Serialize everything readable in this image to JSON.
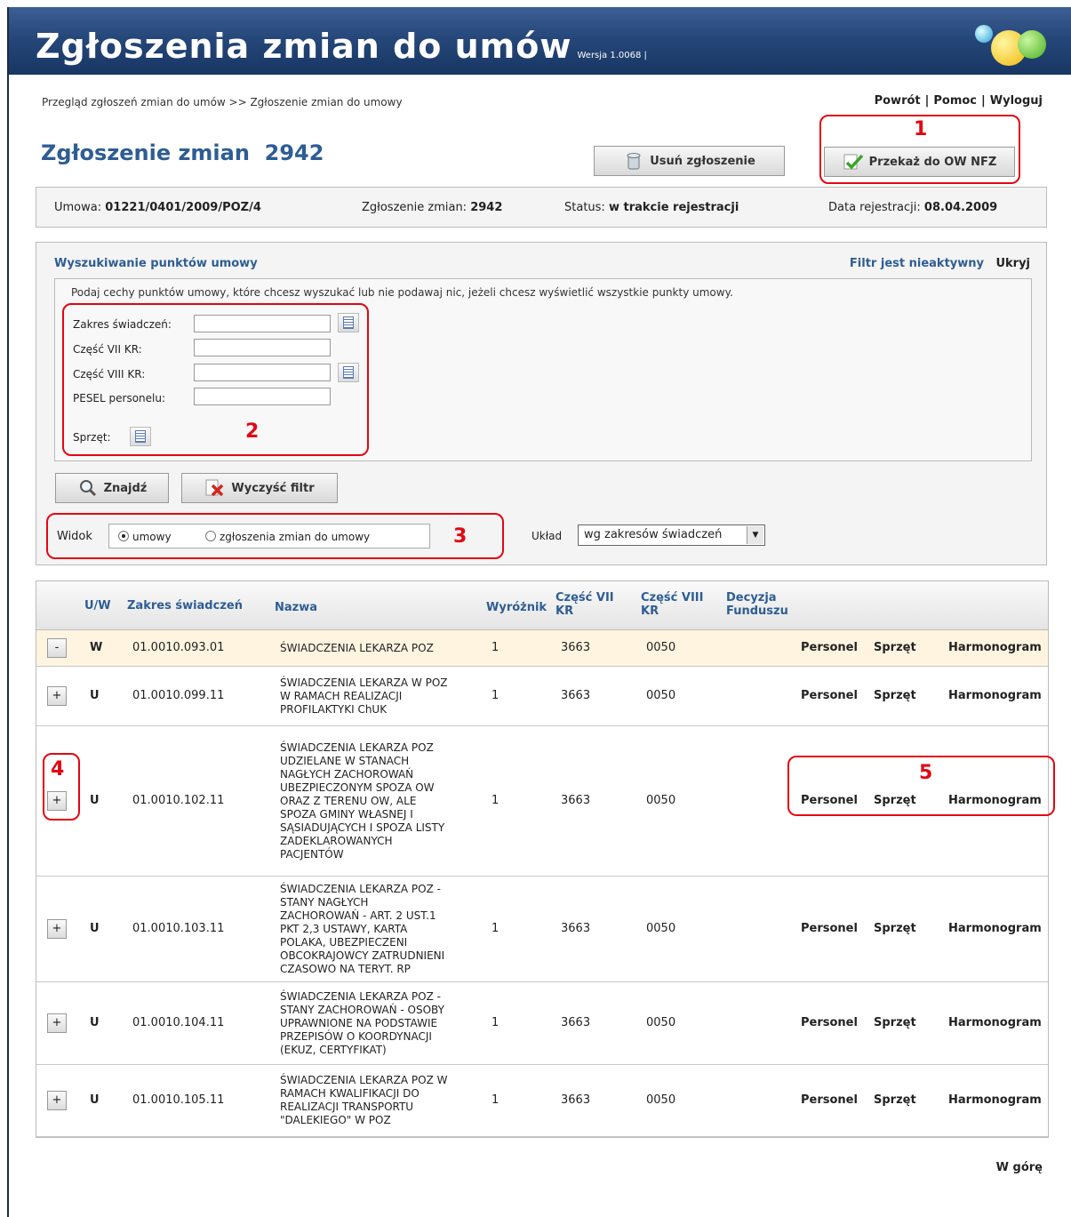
{
  "app": {
    "title": "Zgłoszenia zmian do umów",
    "version": "Wersja 1.0068 |"
  },
  "breadcrumb": "Przegląd zgłoszeń zmian do umów >> Zgłoszenie zmian do umowy",
  "top_links": {
    "back": "Powrót",
    "help": "Pomoc",
    "logout": "Wyloguj",
    "sep": "|"
  },
  "page_title": "Zgłoszenie zmian  2942",
  "buttons": {
    "delete": "Usuń zgłoszenie",
    "send": "Przekaż do OW NFZ",
    "find": "Znajdź",
    "clear": "Wyczyść filtr"
  },
  "info": {
    "contract_label": "Umowa:",
    "contract": "01221/0401/2009/POZ/4",
    "change_label": "Zgłoszenie zmian:",
    "change": "2942",
    "status_label": "Status:",
    "status": "w trakcie rejestracji",
    "date_label": "Data rejestracji:",
    "date": "08.04.2009"
  },
  "search": {
    "title": "Wyszukiwanie punktów umowy",
    "filter_status": "Filtr jest nieaktywny",
    "hide": "Ukryj",
    "hint": "Podaj cechy punktów umowy, które chcesz wyszukać lub nie podawaj nic, jeżeli chcesz wyświetlić wszystkie punkty umowy.",
    "fields": {
      "scope": "Zakres świadczeń:",
      "part7": "Część VII KR:",
      "part8": "Część VIII KR:",
      "pesel": "PESEL personelu:",
      "equipment": "Sprzęt:"
    }
  },
  "view": {
    "label": "Widok",
    "option1": "umowy",
    "option2": "zgłoszenia zmian do umowy",
    "layout_label": "Układ",
    "layout_value": "wg zakresów świadczeń"
  },
  "annotations": [
    "1",
    "2",
    "3",
    "4",
    "5"
  ],
  "table": {
    "headers": {
      "uw": "U/W",
      "scope": "Zakres świadczeń",
      "name": "Nazwa",
      "marker": "Wyróżnik",
      "part7a": "Część VII",
      "part7b": "KR",
      "part8a": "Część VIII",
      "part8b": "KR",
      "decisiona": "Decyzja",
      "decisionb": "Funduszu"
    },
    "actions": {
      "staff": "Personel",
      "equipment": "Sprzęt",
      "schedule": "Harmonogram"
    },
    "rows": [
      {
        "toggle": "-",
        "uw": "W",
        "code": "01.0010.093.01",
        "name": [
          "ŚWIADCZENIA LEKARZA POZ"
        ],
        "marker": "1",
        "part7": "3663",
        "part8": "0050"
      },
      {
        "toggle": "+",
        "uw": "U",
        "code": "01.0010.099.11",
        "name": [
          "ŚWIADCZENIA LEKARZA W POZ",
          "W RAMACH REALIZACJI",
          "PROFILAKTYKI ChUK"
        ],
        "marker": "1",
        "part7": "3663",
        "part8": "0050"
      },
      {
        "toggle": "+",
        "uw": "U",
        "code": "01.0010.102.11",
        "name": [
          "ŚWIADCZENIA LEKARZA POZ",
          "UDZIELANE W STANACH",
          "NAGŁYCH ZACHOROWAŃ",
          "UBEZPIECZONYM SPOZA OW",
          "ORAZ Z TERENU OW, ALE",
          "SPOZA GMINY WŁASNEJ I",
          "SĄSIADUJĄCYCH I SPOZA LISTY",
          "ZADEKLAROWANYCH",
          "PACJENTÓW"
        ],
        "marker": "1",
        "part7": "3663",
        "part8": "0050"
      },
      {
        "toggle": "+",
        "uw": "U",
        "code": "01.0010.103.11",
        "name": [
          "ŚWIADCZENIA LEKARZA POZ -",
          "STANY NAGŁYCH",
          "ZACHOROWAŃ - ART. 2 UST.1",
          "PKT 2,3 USTAWY, KARTA",
          "POLAKA, UBEZPIECZENI",
          "OBCOKRAJOWCY ZATRUDNIENI",
          "CZASOWO NA TERYT. RP"
        ],
        "marker": "1",
        "part7": "3663",
        "part8": "0050"
      },
      {
        "toggle": "+",
        "uw": "U",
        "code": "01.0010.104.11",
        "name": [
          "ŚWIADCZENIA LEKARZA POZ -",
          "STANY ZACHOROWAŃ - OSOBY",
          "UPRAWNIONE NA PODSTAWIE",
          "PRZEPISÓW O KOORDYNACJI",
          "(EKUZ, CERTYFIKAT)"
        ],
        "marker": "1",
        "part7": "3663",
        "part8": "0050"
      },
      {
        "toggle": "+",
        "uw": "U",
        "code": "01.0010.105.11",
        "name": [
          "ŚWIADCZENIA LEKARZA POZ W",
          "RAMACH KWALIFIKACJI DO",
          "REALIZACJI TRANSPORTU",
          "\"DALEKIEGO\" W POZ"
        ],
        "marker": "1",
        "part7": "3663",
        "part8": "0050"
      }
    ]
  },
  "back_to_top": "W górę"
}
